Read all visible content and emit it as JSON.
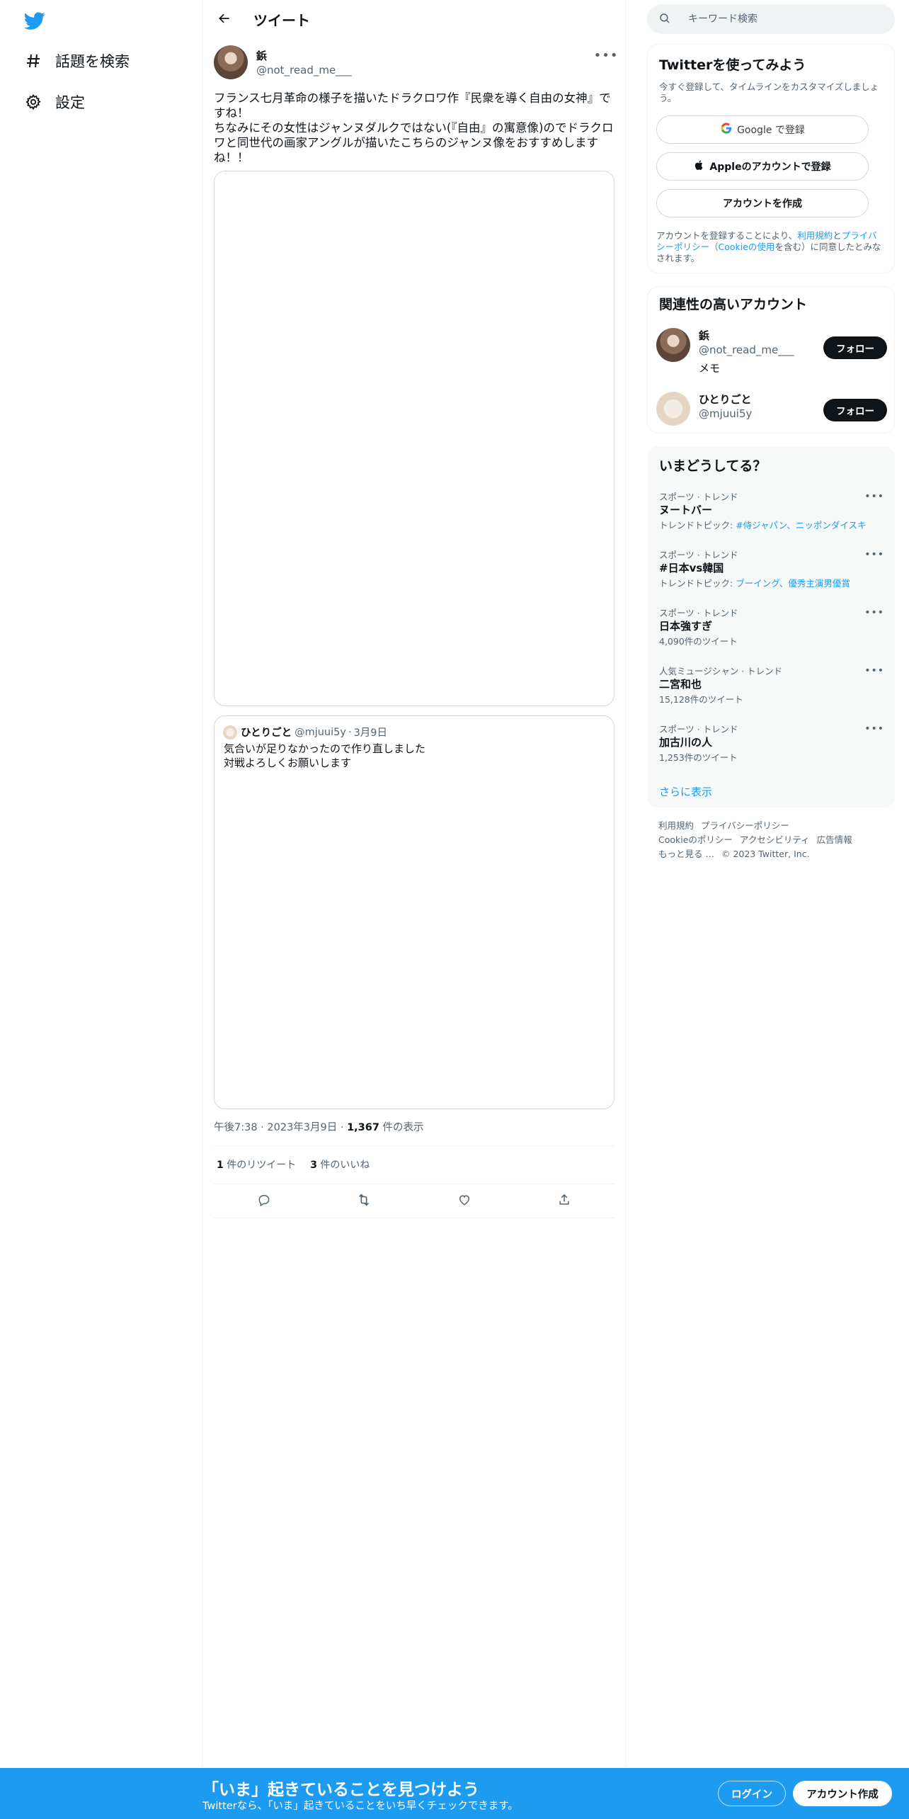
{
  "brand": {
    "accent": "#1d9bf0",
    "text": "#0f1419",
    "muted": "#536471"
  },
  "nav": {
    "items": [
      {
        "icon": "hashtag-icon",
        "label": "話題を検索"
      },
      {
        "icon": "gear-icon",
        "label": "設定"
      }
    ]
  },
  "header": {
    "title": "ツイート"
  },
  "tweet": {
    "author_name": "鋲",
    "author_handle": "@not_read_me___",
    "text": "フランス七月革命の様子を描いたドラクロワ作『民衆を導く自由の女神』ですね！\nちなみにその女性はジャンヌダルクではない(『自由』の寓意像)のでドラクロワと同世代の画家アングルが描いたこちらのジャンヌ像をおすすめしますね！！",
    "quote": {
      "name": "ひとりごと",
      "handle": "@mjuui5y",
      "date": "3月9日",
      "text": "気合いが足りなかったので作り直しました\n対戦よろしくお願いします"
    },
    "time": "午後7:38",
    "date": "2023年3月9日",
    "views_count": "1,367",
    "views_label": " 件の表示",
    "retweets_count": "1",
    "retweets_label": " 件のリツイート",
    "likes_count": "3",
    "likes_label": " 件のいいね"
  },
  "search": {
    "placeholder": "キーワード検索"
  },
  "signup_card": {
    "title": "Twitterを使ってみよう",
    "subtitle": "今すぐ登録して、タイムラインをカスタマイズしましょう。",
    "google_label": "Google で登録",
    "apple_label": "Appleのアカウントで登録",
    "create_label": "アカウントを作成",
    "terms_prefix": "アカウントを登録することにより、",
    "terms_link1": "利用規約",
    "terms_and": "と",
    "terms_link2": "プライバシーポリシー（Cookieの使用",
    "terms_suffix": "を含む）に同意したとみなされます。"
  },
  "related": {
    "title": "関連性の高いアカウント",
    "accounts": [
      {
        "name": "鋲",
        "handle": "@not_read_me___",
        "bio": "メモ",
        "follow": "フォロー"
      },
      {
        "name": "ひとりごと",
        "handle": "@mjuui5y",
        "bio": "",
        "follow": "フォロー"
      }
    ]
  },
  "trends": {
    "title": "いまどうしてる？",
    "items": [
      {
        "category": "スポーツ · トレンド",
        "name": "ヌートバー",
        "sub_prefix": "トレンドトピック: ",
        "sub_links": "#侍ジャパン、ニッポンダイスキ",
        "count": ""
      },
      {
        "category": "スポーツ · トレンド",
        "name": "#日本vs韓国",
        "sub_prefix": "トレンドトピック: ",
        "sub_links": "ブーイング、優秀主演男優賞",
        "count": ""
      },
      {
        "category": "スポーツ · トレンド",
        "name": "日本強すぎ",
        "sub_prefix": "",
        "sub_links": "",
        "count": "4,090件のツイート"
      },
      {
        "category": "人気ミュージシャン · トレンド",
        "name": "二宮和也",
        "sub_prefix": "",
        "sub_links": "",
        "count": "15,128件のツイート"
      },
      {
        "category": "スポーツ · トレンド",
        "name": "加古川の人",
        "sub_prefix": "",
        "sub_links": "",
        "count": "1,253件のツイート"
      }
    ],
    "show_more": "さらに表示"
  },
  "footer": {
    "links": [
      "利用規約",
      "プライバシーポリシー",
      "Cookieのポリシー",
      "アクセシビリティ",
      "広告情報",
      "もっと見る …"
    ],
    "copyright": "© 2023 Twitter, Inc."
  },
  "banner": {
    "title": "「いま」起きていることを見つけよう",
    "subtitle": "Twitterなら、「いま」起きていることをいち早くチェックできます。",
    "login": "ログイン",
    "signup": "アカウント作成"
  }
}
